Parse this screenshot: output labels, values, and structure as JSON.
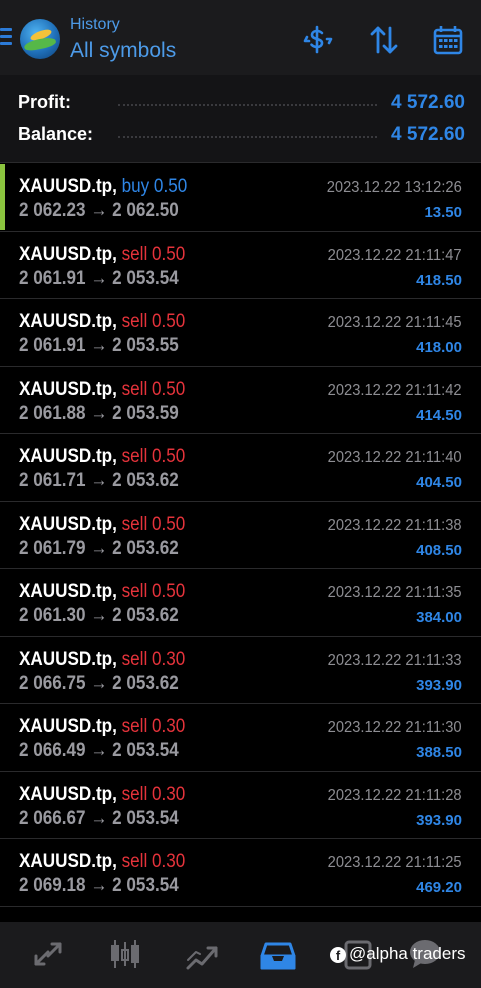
{
  "header": {
    "subtitle": "History",
    "title": "All symbols",
    "icons": [
      "menu-icon",
      "dollar-refresh-icon",
      "sort-icon",
      "calendar-icon"
    ]
  },
  "summary": {
    "profit_label": "Profit:",
    "profit_value": "4 572.60",
    "balance_label": "Balance:",
    "balance_value": "4 572.60"
  },
  "colors": {
    "accent_blue": "#2f86e6",
    "sell_red": "#e5333b",
    "buy_accent_green": "#8bc43f"
  },
  "deals": [
    {
      "symbol": "XAUUSD.tp,",
      "side": "buy 0.50",
      "prices": "2 062.23 → 2 062.50",
      "time": "2023.12.22 13:12:26",
      "profit": "13.50"
    },
    {
      "symbol": "XAUUSD.tp,",
      "side": "sell 0.50",
      "prices": "2 061.91 → 2 053.54",
      "time": "2023.12.22 21:11:47",
      "profit": "418.50"
    },
    {
      "symbol": "XAUUSD.tp,",
      "side": "sell 0.50",
      "prices": "2 061.91 → 2 053.55",
      "time": "2023.12.22 21:11:45",
      "profit": "418.00"
    },
    {
      "symbol": "XAUUSD.tp,",
      "side": "sell 0.50",
      "prices": "2 061.88 → 2 053.59",
      "time": "2023.12.22 21:11:42",
      "profit": "414.50"
    },
    {
      "symbol": "XAUUSD.tp,",
      "side": "sell 0.50",
      "prices": "2 061.71 → 2 053.62",
      "time": "2023.12.22 21:11:40",
      "profit": "404.50"
    },
    {
      "symbol": "XAUUSD.tp,",
      "side": "sell 0.50",
      "prices": "2 061.79 → 2 053.62",
      "time": "2023.12.22 21:11:38",
      "profit": "408.50"
    },
    {
      "symbol": "XAUUSD.tp,",
      "side": "sell 0.50",
      "prices": "2 061.30 → 2 053.62",
      "time": "2023.12.22 21:11:35",
      "profit": "384.00"
    },
    {
      "symbol": "XAUUSD.tp,",
      "side": "sell 0.30",
      "prices": "2 066.75 → 2 053.62",
      "time": "2023.12.22 21:11:33",
      "profit": "393.90"
    },
    {
      "symbol": "XAUUSD.tp,",
      "side": "sell 0.30",
      "prices": "2 066.49 → 2 053.54",
      "time": "2023.12.22 21:11:30",
      "profit": "388.50"
    },
    {
      "symbol": "XAUUSD.tp,",
      "side": "sell 0.30",
      "prices": "2 066.67 → 2 053.54",
      "time": "2023.12.22 21:11:28",
      "profit": "393.90"
    },
    {
      "symbol": "XAUUSD.tp,",
      "side": "sell 0.30",
      "prices": "2 069.18 → 2 053.54",
      "time": "2023.12.22 21:11:25",
      "profit": "469.20"
    }
  ],
  "bottom_tabs": [
    "quotes-icon",
    "chart-icon",
    "trade-icon",
    "history-icon",
    "messages-icon",
    "chat-icon"
  ],
  "watermark": "@alpha traders"
}
